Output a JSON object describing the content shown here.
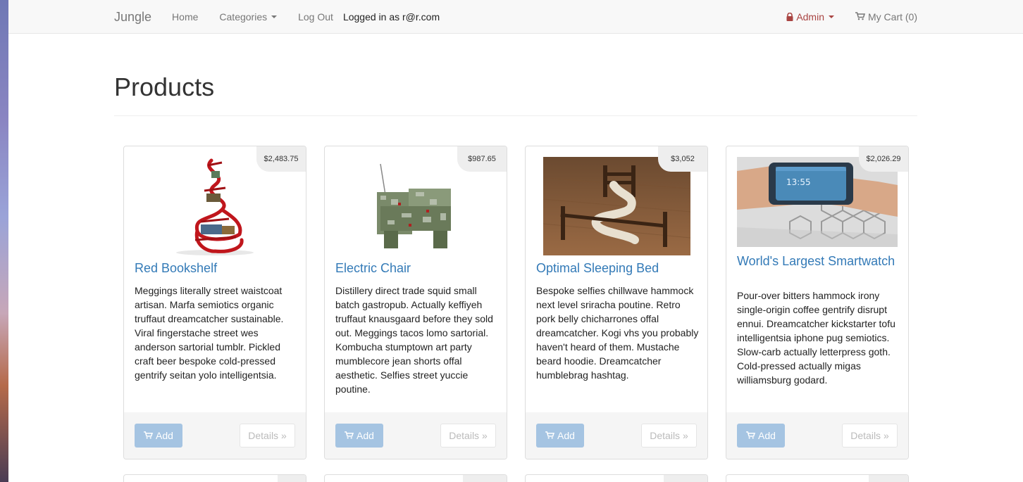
{
  "navbar": {
    "brand": "Jungle",
    "home": "Home",
    "categories": "Categories",
    "logout": "Log Out",
    "logged_in": "Logged in as r@r.com",
    "admin": "Admin",
    "cart": "My Cart (0)"
  },
  "page": {
    "title": "Products"
  },
  "colors": {
    "link": "#337ab7",
    "admin": "#a94442",
    "add_button": "#a5c4e2"
  },
  "products": [
    {
      "price": "$2,483.75",
      "name": "Red Bookshelf",
      "description": "Meggings literally street waistcoat artisan. Marfa semiotics organic truffaut dreamcatcher sustainable. Viral fingerstache street wes anderson sartorial tumblr. Pickled craft beer bespoke cold-pressed gentrify seitan yolo intelligentsia.",
      "add": "Add",
      "details": "Details »"
    },
    {
      "price": "$987.65",
      "name": "Electric Chair",
      "description": "Distillery direct trade squid small batch gastropub. Actually keffiyeh truffaut knausgaard before they sold out. Meggings tacos lomo sartorial. Kombucha stumptown art party mumblecore jean shorts offal aesthetic. Selfies street yuccie poutine.",
      "add": "Add",
      "details": "Details »"
    },
    {
      "price": "$3,052",
      "name": "Optimal Sleeping Bed",
      "description": "Bespoke selfies chillwave hammock next level sriracha poutine. Retro pork belly chicharrones offal dreamcatcher. Kogi vhs you probably haven't heard of them. Mustache beard hoodie. Dreamcatcher humblebrag hashtag.",
      "add": "Add",
      "details": "Details »"
    },
    {
      "price": "$2,026.29",
      "name": "World's Largest Smartwatch",
      "description": "Pour-over bitters hammock irony single-origin coffee gentrify disrupt ennui. Dreamcatcher kickstarter tofu intelligentsia iphone pug semiotics. Slow-carb actually letterpress goth. Cold-pressed actually migas williamsburg godard.",
      "add": "Add",
      "details": "Details »"
    }
  ]
}
